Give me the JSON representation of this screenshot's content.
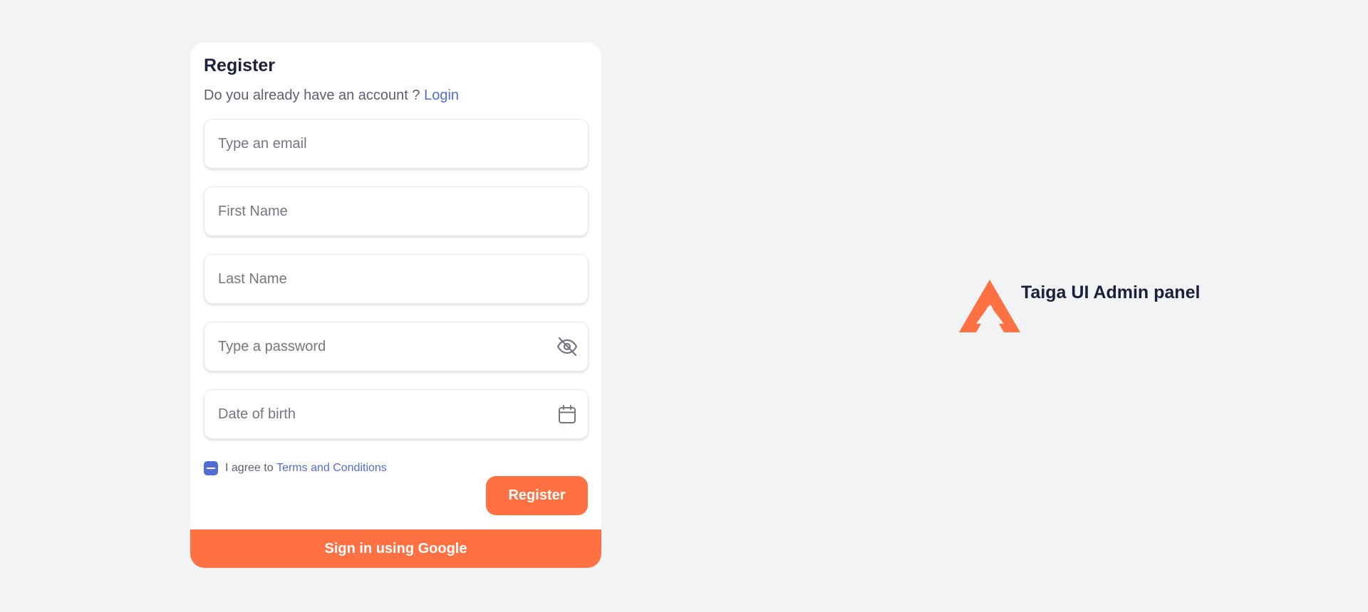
{
  "register_form": {
    "title": "Register",
    "subtitle_prefix": "Do you already have an account ? ",
    "login_link": "Login",
    "fields": {
      "email": {
        "placeholder": "Type an email",
        "value": ""
      },
      "first_name": {
        "placeholder": "First Name",
        "value": ""
      },
      "last_name": {
        "placeholder": "Last Name",
        "value": ""
      },
      "password": {
        "placeholder": "Type a password",
        "value": "",
        "icon": "eye-off-icon"
      },
      "date_of_birth": {
        "placeholder": "Date of birth",
        "value": "",
        "icon": "calendar-icon"
      }
    },
    "agree_prefix": "I agree to ",
    "terms_link": "Terms and Conditions",
    "agree_state": "indeterminate",
    "register_button": "Register",
    "google_button": "Sign in using Google"
  },
  "brand": {
    "title": "Taiga UI Admin panel",
    "logo_icon": "taiga-logo-icon"
  },
  "colors": {
    "background": "#f2f3f5",
    "accent": "#ff7043",
    "link": "#526ed3",
    "text_primary": "#1b1f3b",
    "text_secondary": "#5c5f73"
  }
}
